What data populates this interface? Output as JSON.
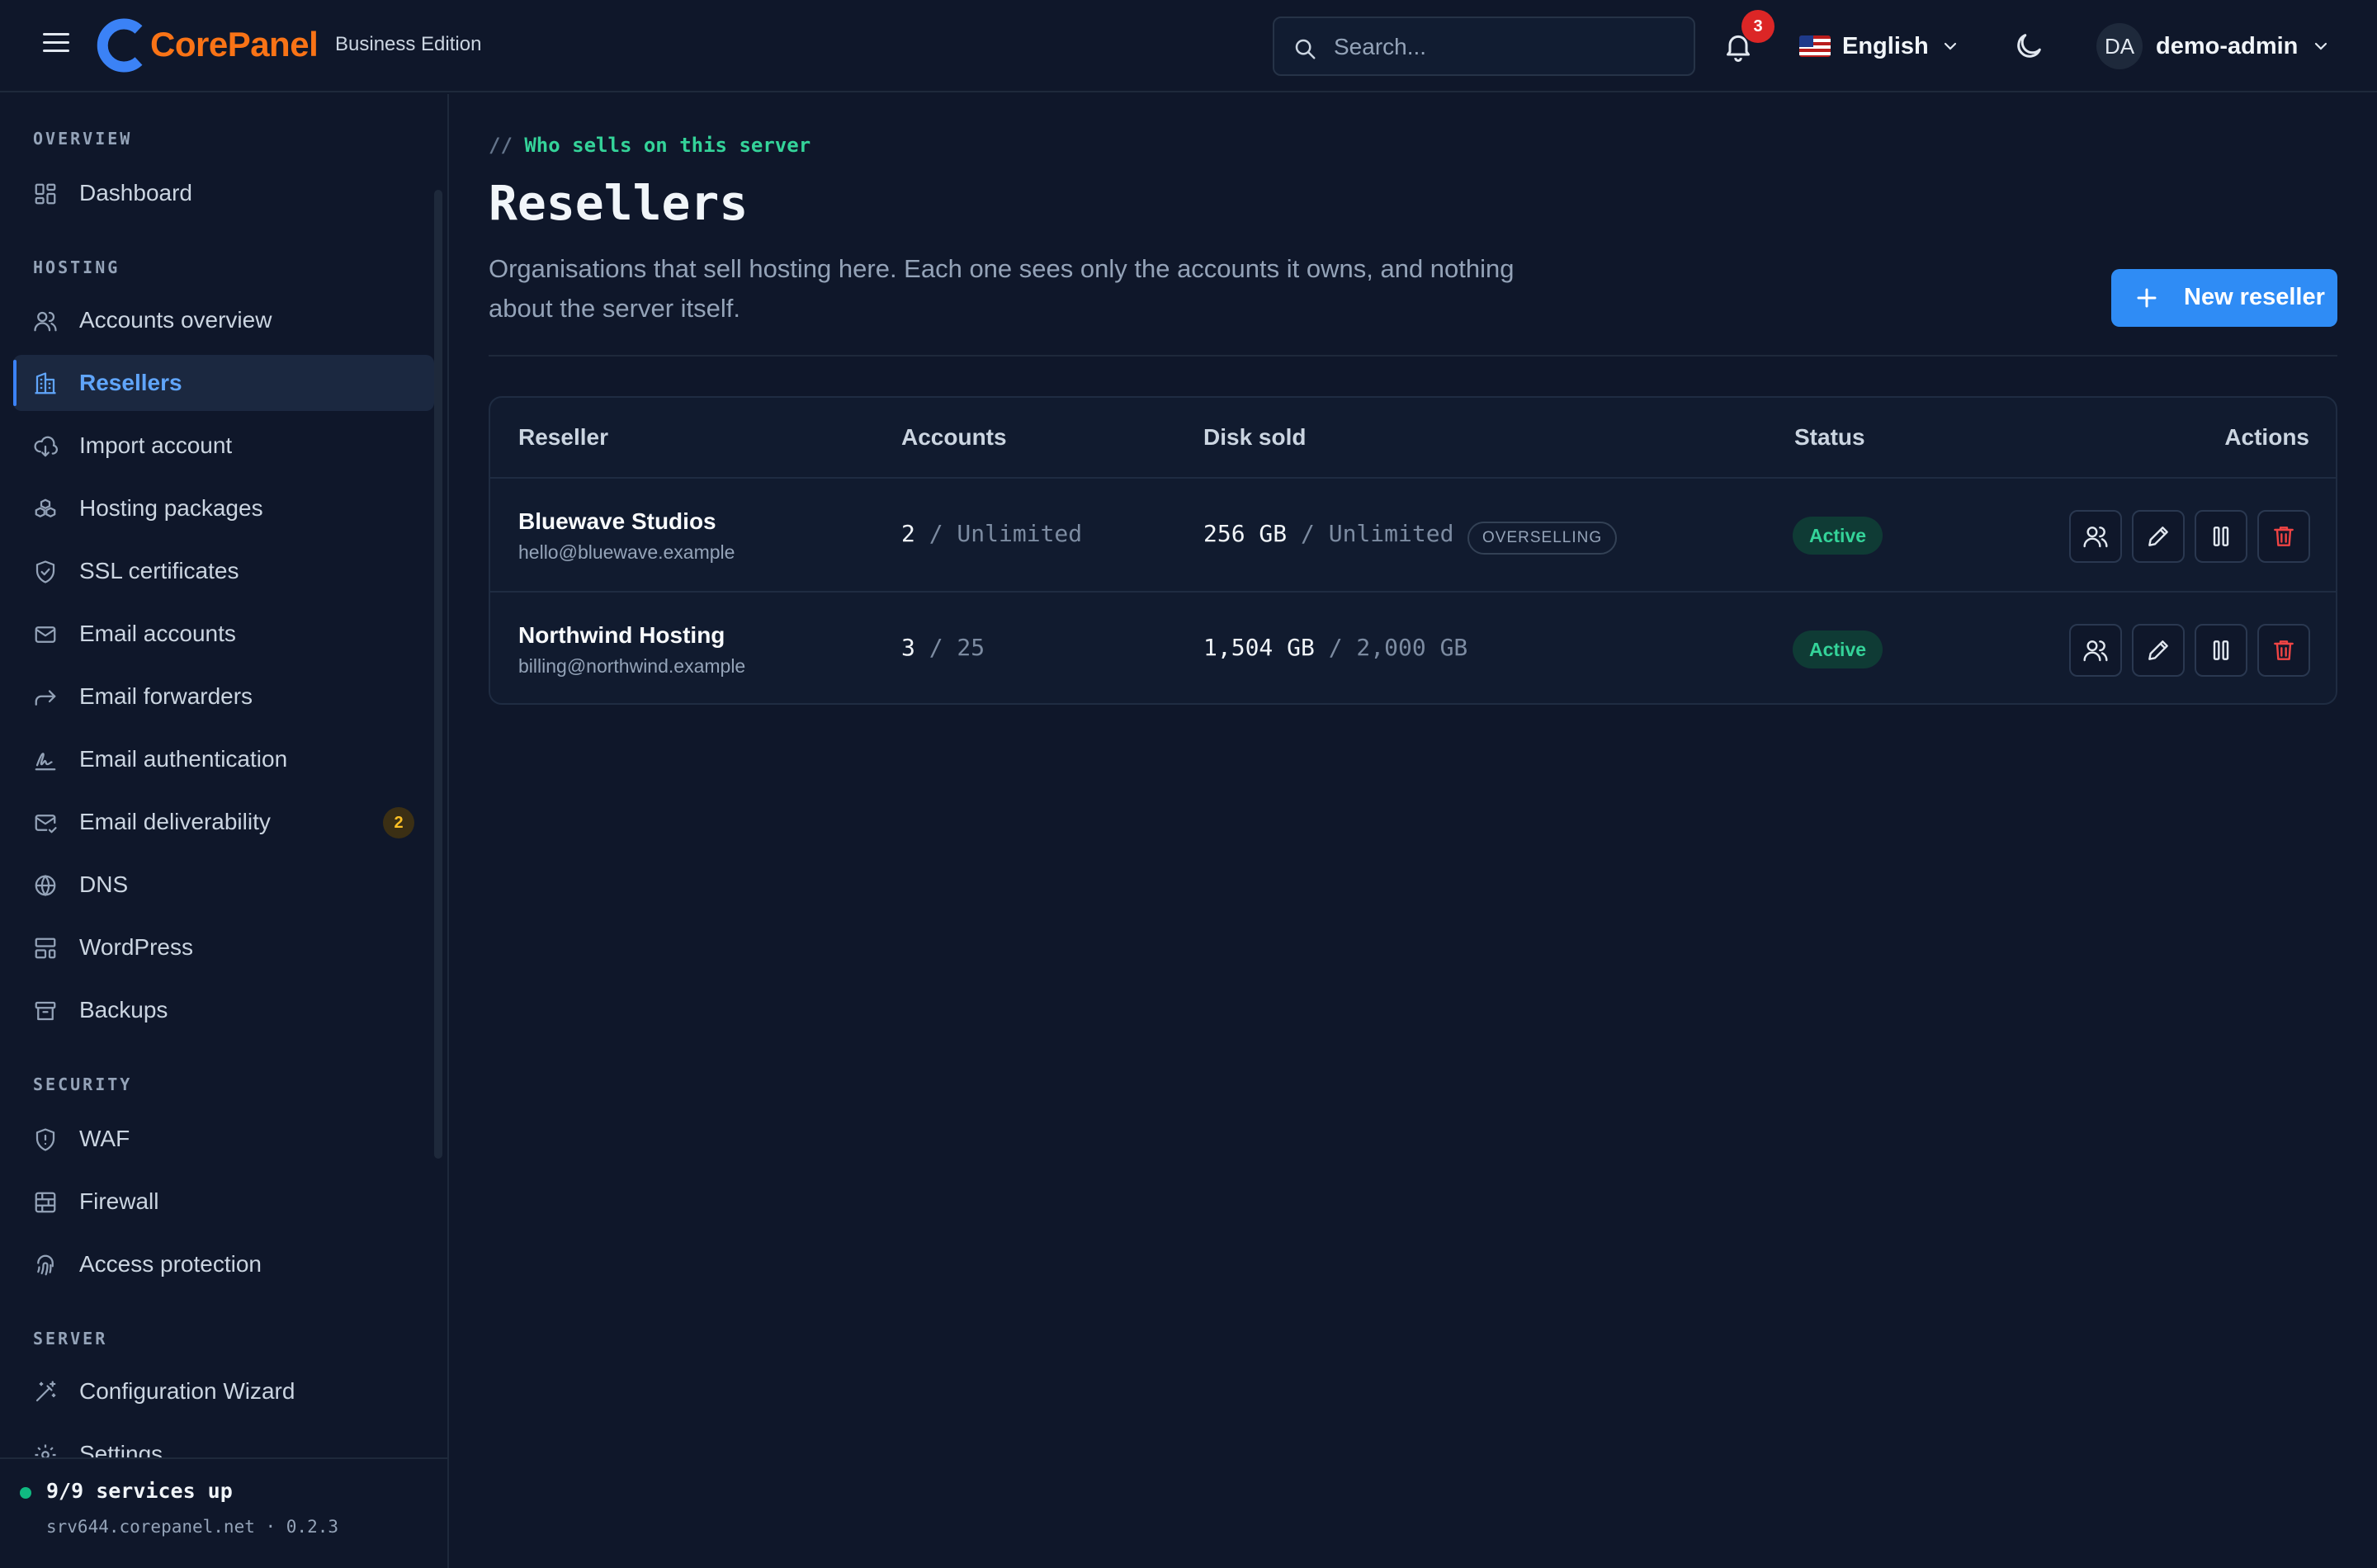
{
  "app": {
    "logo_text": "CorePanel",
    "edition": "Business Edition"
  },
  "topbar": {
    "search_placeholder": "Search...",
    "notifications_count": "3",
    "language": "English",
    "user_initials": "DA",
    "user_name": "demo-admin"
  },
  "sidebar": {
    "sections": {
      "overview": "OVERVIEW",
      "hosting": "HOSTING",
      "security": "SECURITY",
      "server": "SERVER"
    },
    "items": {
      "dashboard": "Dashboard",
      "accounts_overview": "Accounts overview",
      "resellers": "Resellers",
      "import_account": "Import account",
      "hosting_packages": "Hosting packages",
      "ssl_certificates": "SSL certificates",
      "email_accounts": "Email accounts",
      "email_forwarders": "Email forwarders",
      "email_authentication": "Email authentication",
      "email_deliverability": "Email deliverability",
      "email_deliverability_badge": "2",
      "dns": "DNS",
      "wordpress": "WordPress",
      "backups": "Backups",
      "waf": "WAF",
      "firewall": "Firewall",
      "access_protection": "Access protection",
      "configuration_wizard": "Configuration Wizard",
      "settings": "Settings"
    },
    "active_item": "resellers",
    "footer": {
      "services_status": "9/9 services up",
      "server_info": "srv644.corepanel.net · 0.2.3"
    }
  },
  "page": {
    "kicker_prefix": "//",
    "kicker": "Who sells on this server",
    "title": "Resellers",
    "description": "Organisations that sell hosting here. Each one sees only the accounts it owns, and nothing about the server itself.",
    "new_button": "New reseller"
  },
  "table": {
    "columns": {
      "reseller": "Reseller",
      "accounts": "Accounts",
      "disk_sold": "Disk sold",
      "status": "Status",
      "actions": "Actions"
    },
    "rows": [
      {
        "name": "Bluewave Studios",
        "email": "hello@bluewave.example",
        "accounts_used": "2",
        "accounts_limit": "/ Unlimited",
        "disk_used": "256 GB",
        "disk_limit": "/ Unlimited",
        "flag": "OVERSELLING",
        "status": "Active"
      },
      {
        "name": "Northwind Hosting",
        "email": "billing@northwind.example",
        "accounts_used": "3",
        "accounts_limit": "/ 25",
        "disk_used": "1,504 GB",
        "disk_limit": "/ 2,000 GB",
        "status": "Active"
      }
    ]
  },
  "colors": {
    "background": "#0f172a",
    "accent": "#2f8cf5",
    "brand": "#f97316",
    "success": "#34d399",
    "danger": "#dc2626"
  }
}
